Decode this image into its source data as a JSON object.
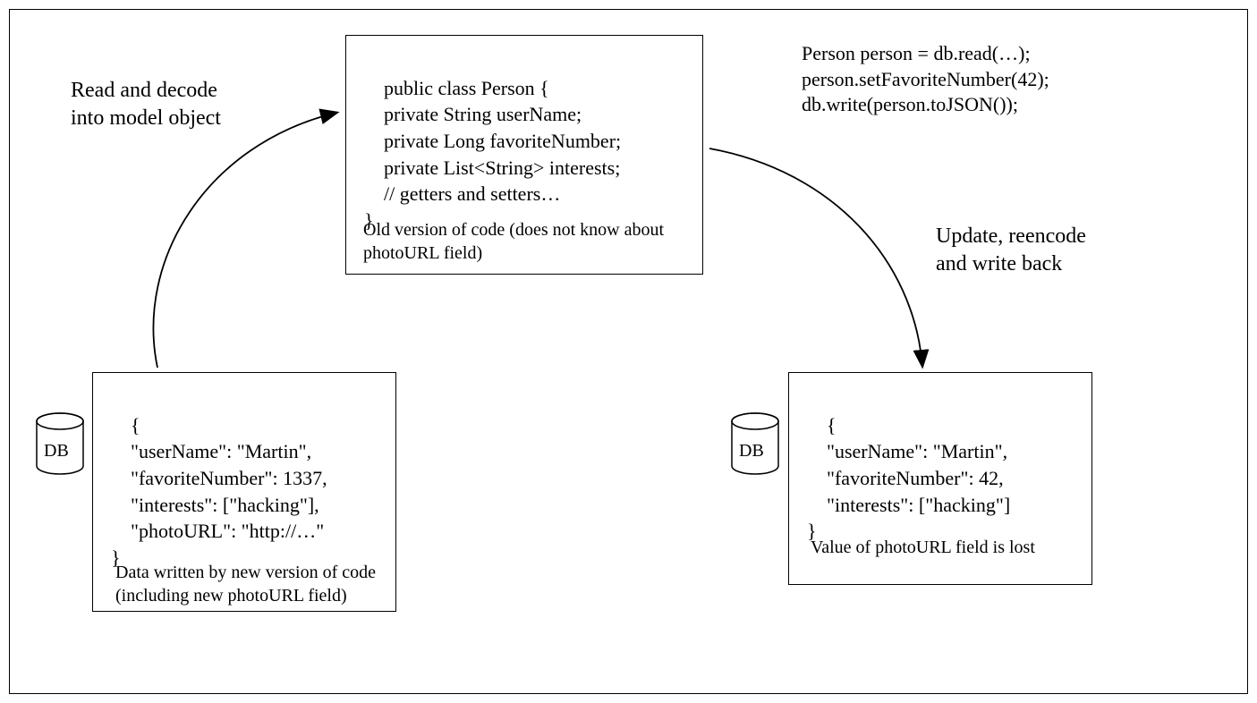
{
  "labels": {
    "read_decode": "Read and decode\ninto model object",
    "update_write": "Update, reencode\nand write back"
  },
  "boxes": {
    "class_code": "public class Person {\n    private String userName;\n    private Long favoriteNumber;\n    private List<String> interests;\n    // getters and setters…\n}",
    "class_caption": "Old version of code (does not know\nabout photoURL field)",
    "usage_code": "Person person = db.read(…);\nperson.setFavoriteNumber(42);\ndb.write(person.toJSON());",
    "json_left": "{\n    \"userName\": \"Martin\",\n    \"favoriteNumber\": 1337,\n    \"interests\": [\"hacking\"],\n    \"photoURL\": \"http://…\"\n}",
    "json_left_caption": "Data written by new version of code\n(including new photoURL field)",
    "json_right": "{\n    \"userName\": \"Martin\",\n    \"favoriteNumber\": 42,\n    \"interests\": [\"hacking\"]\n}",
    "json_right_caption": "Value of photoURL field is lost"
  },
  "db": {
    "label": "DB"
  }
}
